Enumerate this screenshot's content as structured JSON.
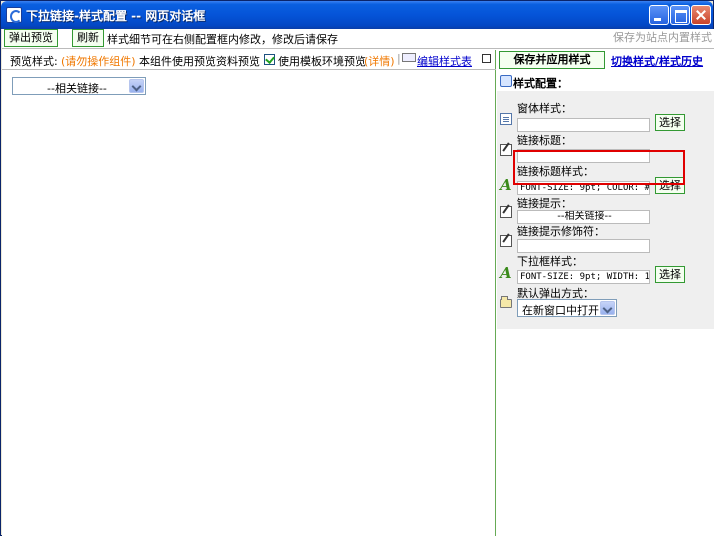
{
  "window": {
    "title": "下拉链接-样式配置 -- 网页对话框"
  },
  "toolbar": {
    "popup_preview": "弹出预览",
    "refresh": "刷新",
    "note": "样式细节可在右侧配置框内修改，修改后请保存",
    "save_as_site_style": "保存为站点内置样式"
  },
  "preview": {
    "label": "预览样式:",
    "warning": "(请勿操作组件)",
    "description": "本组件使用预览资料预览",
    "use_template_preview": "使用模板环境预览",
    "use_template_checked": true,
    "details_link": "(详情)",
    "separator": "|",
    "edit_stylesheet": "编辑样式表",
    "select_value": "--相关链接--"
  },
  "config": {
    "save_apply": "保存并应用样式",
    "switch_history": "切换样式/样式历史",
    "heading": "样式配置：",
    "pick_label": "选择",
    "fields": {
      "window_style": {
        "label": "窗体样式：",
        "value": ""
      },
      "link_title": {
        "label": "链接标题：",
        "value": ""
      },
      "link_title_style": {
        "label": "链接标题样式：",
        "value": "FONT-SIZE: 9pt; COLOR: #"
      },
      "link_hint": {
        "label": "链接提示：",
        "value": "--相关链接--"
      },
      "link_hint_modifier": {
        "label": "链接提示修饰符：",
        "value": ""
      },
      "dropdown_style": {
        "label": "下拉框样式：",
        "value": "FONT-SIZE: 9pt; WIDTH: 1!"
      },
      "default_popup": {
        "label": "默认弹出方式：",
        "value": "在新窗口中打开"
      }
    }
  },
  "colors": {
    "titlebar": "#0554D8",
    "border_green": "#339933",
    "highlight_red": "#E00000",
    "warning_orange": "#F07800",
    "link_blue": "#0000CC"
  }
}
